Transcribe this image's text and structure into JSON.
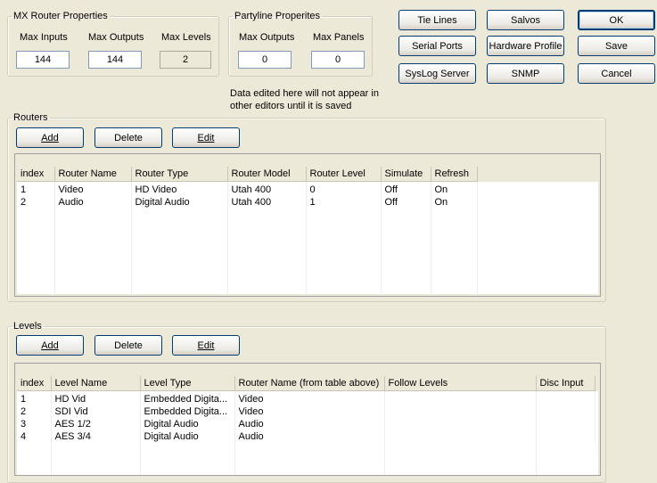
{
  "mx_router": {
    "title": "MX Router Properties",
    "max_inputs_label": "Max Inputs",
    "max_inputs_value": "144",
    "max_outputs_label": "Max Outputs",
    "max_outputs_value": "144",
    "max_levels_label": "Max Levels",
    "max_levels_value": "2"
  },
  "partyline": {
    "title": "Partyline Properites",
    "max_outputs_label": "Max Outputs",
    "max_outputs_value": "0",
    "max_panels_label": "Max Panels",
    "max_panels_value": "0"
  },
  "buttons": {
    "tie_lines": "Tie Lines",
    "salvos": "Salvos",
    "ok": "OK",
    "serial_ports": "Serial Ports",
    "hardware_profile": "Hardware Profile",
    "save": "Save",
    "syslog_server": "SysLog Server",
    "snmp": "SNMP",
    "cancel": "Cancel"
  },
  "notice": {
    "line1": "Data edited here will not appear in",
    "line2": "other editors until it is saved"
  },
  "routers": {
    "title": "Routers",
    "add": "Add",
    "delete": "Delete",
    "edit": "Edit",
    "columns": [
      "index",
      "Router Name",
      "Router Type",
      "Router Model",
      "Router Level",
      "Simulate",
      "Refresh"
    ],
    "rows": [
      [
        "1",
        "Video",
        "HD Video",
        "Utah 400",
        "0",
        "Off",
        "On"
      ],
      [
        "2",
        "Audio",
        "Digital Audio",
        "Utah 400",
        "1",
        "Off",
        "On"
      ]
    ]
  },
  "levels": {
    "title": "Levels",
    "add": "Add",
    "delete": "Delete",
    "edit": "Edit",
    "columns": [
      "index",
      "Level Name",
      "Level Type",
      "Router Name (from table above)",
      "Follow Levels",
      "Disc Input"
    ],
    "rows": [
      [
        "1",
        "HD Vid",
        "Embedded Digita...",
        "Video",
        "",
        ""
      ],
      [
        "2",
        "SDI Vid",
        "Embedded Digita...",
        "Video",
        "",
        ""
      ],
      [
        "3",
        "AES 1/2",
        "Digital Audio",
        "Audio",
        "",
        ""
      ],
      [
        "4",
        "AES 3/4",
        "Digital Audio",
        "Audio",
        "",
        ""
      ]
    ]
  }
}
